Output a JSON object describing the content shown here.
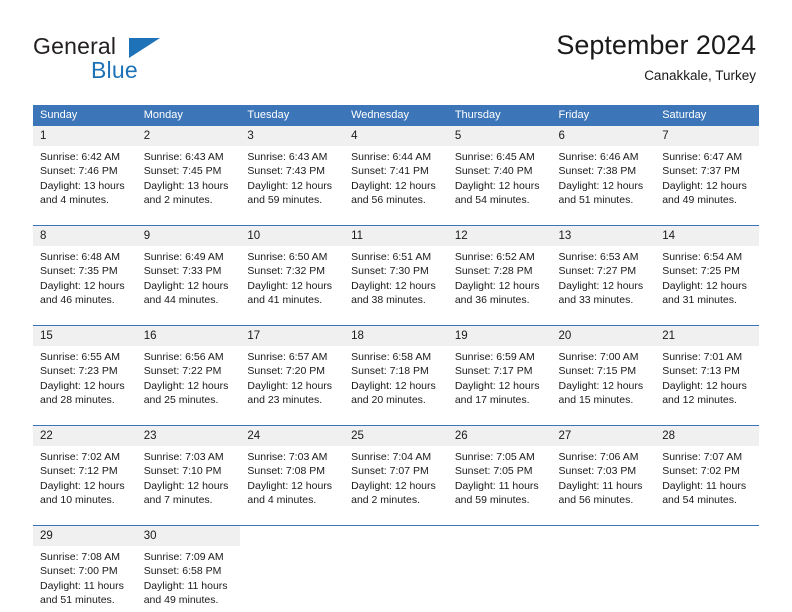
{
  "brand": {
    "name_top": "General",
    "name_bottom": "Blue",
    "triangle_icon": "blue-triangle-logo-mark",
    "accent_color": "#1e72b8"
  },
  "header": {
    "title": "September 2024",
    "subtitle": "Canakkale, Turkey"
  },
  "theme": {
    "header_blue": "#3d76b8",
    "daynum_band": "#f0f0f0",
    "cell_background": "#ffffff",
    "text": "#1a1a1a"
  },
  "weekdays": [
    "Sunday",
    "Monday",
    "Tuesday",
    "Wednesday",
    "Thursday",
    "Friday",
    "Saturday"
  ],
  "weeks": [
    [
      {
        "day": "1",
        "sunrise": "Sunrise: 6:42 AM",
        "sunset": "Sunset: 7:46 PM",
        "daylight_1": "Daylight: 13 hours",
        "daylight_2": "and 4 minutes."
      },
      {
        "day": "2",
        "sunrise": "Sunrise: 6:43 AM",
        "sunset": "Sunset: 7:45 PM",
        "daylight_1": "Daylight: 13 hours",
        "daylight_2": "and 2 minutes."
      },
      {
        "day": "3",
        "sunrise": "Sunrise: 6:43 AM",
        "sunset": "Sunset: 7:43 PM",
        "daylight_1": "Daylight: 12 hours",
        "daylight_2": "and 59 minutes."
      },
      {
        "day": "4",
        "sunrise": "Sunrise: 6:44 AM",
        "sunset": "Sunset: 7:41 PM",
        "daylight_1": "Daylight: 12 hours",
        "daylight_2": "and 56 minutes."
      },
      {
        "day": "5",
        "sunrise": "Sunrise: 6:45 AM",
        "sunset": "Sunset: 7:40 PM",
        "daylight_1": "Daylight: 12 hours",
        "daylight_2": "and 54 minutes."
      },
      {
        "day": "6",
        "sunrise": "Sunrise: 6:46 AM",
        "sunset": "Sunset: 7:38 PM",
        "daylight_1": "Daylight: 12 hours",
        "daylight_2": "and 51 minutes."
      },
      {
        "day": "7",
        "sunrise": "Sunrise: 6:47 AM",
        "sunset": "Sunset: 7:37 PM",
        "daylight_1": "Daylight: 12 hours",
        "daylight_2": "and 49 minutes."
      }
    ],
    [
      {
        "day": "8",
        "sunrise": "Sunrise: 6:48 AM",
        "sunset": "Sunset: 7:35 PM",
        "daylight_1": "Daylight: 12 hours",
        "daylight_2": "and 46 minutes."
      },
      {
        "day": "9",
        "sunrise": "Sunrise: 6:49 AM",
        "sunset": "Sunset: 7:33 PM",
        "daylight_1": "Daylight: 12 hours",
        "daylight_2": "and 44 minutes."
      },
      {
        "day": "10",
        "sunrise": "Sunrise: 6:50 AM",
        "sunset": "Sunset: 7:32 PM",
        "daylight_1": "Daylight: 12 hours",
        "daylight_2": "and 41 minutes."
      },
      {
        "day": "11",
        "sunrise": "Sunrise: 6:51 AM",
        "sunset": "Sunset: 7:30 PM",
        "daylight_1": "Daylight: 12 hours",
        "daylight_2": "and 38 minutes."
      },
      {
        "day": "12",
        "sunrise": "Sunrise: 6:52 AM",
        "sunset": "Sunset: 7:28 PM",
        "daylight_1": "Daylight: 12 hours",
        "daylight_2": "and 36 minutes."
      },
      {
        "day": "13",
        "sunrise": "Sunrise: 6:53 AM",
        "sunset": "Sunset: 7:27 PM",
        "daylight_1": "Daylight: 12 hours",
        "daylight_2": "and 33 minutes."
      },
      {
        "day": "14",
        "sunrise": "Sunrise: 6:54 AM",
        "sunset": "Sunset: 7:25 PM",
        "daylight_1": "Daylight: 12 hours",
        "daylight_2": "and 31 minutes."
      }
    ],
    [
      {
        "day": "15",
        "sunrise": "Sunrise: 6:55 AM",
        "sunset": "Sunset: 7:23 PM",
        "daylight_1": "Daylight: 12 hours",
        "daylight_2": "and 28 minutes."
      },
      {
        "day": "16",
        "sunrise": "Sunrise: 6:56 AM",
        "sunset": "Sunset: 7:22 PM",
        "daylight_1": "Daylight: 12 hours",
        "daylight_2": "and 25 minutes."
      },
      {
        "day": "17",
        "sunrise": "Sunrise: 6:57 AM",
        "sunset": "Sunset: 7:20 PM",
        "daylight_1": "Daylight: 12 hours",
        "daylight_2": "and 23 minutes."
      },
      {
        "day": "18",
        "sunrise": "Sunrise: 6:58 AM",
        "sunset": "Sunset: 7:18 PM",
        "daylight_1": "Daylight: 12 hours",
        "daylight_2": "and 20 minutes."
      },
      {
        "day": "19",
        "sunrise": "Sunrise: 6:59 AM",
        "sunset": "Sunset: 7:17 PM",
        "daylight_1": "Daylight: 12 hours",
        "daylight_2": "and 17 minutes."
      },
      {
        "day": "20",
        "sunrise": "Sunrise: 7:00 AM",
        "sunset": "Sunset: 7:15 PM",
        "daylight_1": "Daylight: 12 hours",
        "daylight_2": "and 15 minutes."
      },
      {
        "day": "21",
        "sunrise": "Sunrise: 7:01 AM",
        "sunset": "Sunset: 7:13 PM",
        "daylight_1": "Daylight: 12 hours",
        "daylight_2": "and 12 minutes."
      }
    ],
    [
      {
        "day": "22",
        "sunrise": "Sunrise: 7:02 AM",
        "sunset": "Sunset: 7:12 PM",
        "daylight_1": "Daylight: 12 hours",
        "daylight_2": "and 10 minutes."
      },
      {
        "day": "23",
        "sunrise": "Sunrise: 7:03 AM",
        "sunset": "Sunset: 7:10 PM",
        "daylight_1": "Daylight: 12 hours",
        "daylight_2": "and 7 minutes."
      },
      {
        "day": "24",
        "sunrise": "Sunrise: 7:03 AM",
        "sunset": "Sunset: 7:08 PM",
        "daylight_1": "Daylight: 12 hours",
        "daylight_2": "and 4 minutes."
      },
      {
        "day": "25",
        "sunrise": "Sunrise: 7:04 AM",
        "sunset": "Sunset: 7:07 PM",
        "daylight_1": "Daylight: 12 hours",
        "daylight_2": "and 2 minutes."
      },
      {
        "day": "26",
        "sunrise": "Sunrise: 7:05 AM",
        "sunset": "Sunset: 7:05 PM",
        "daylight_1": "Daylight: 11 hours",
        "daylight_2": "and 59 minutes."
      },
      {
        "day": "27",
        "sunrise": "Sunrise: 7:06 AM",
        "sunset": "Sunset: 7:03 PM",
        "daylight_1": "Daylight: 11 hours",
        "daylight_2": "and 56 minutes."
      },
      {
        "day": "28",
        "sunrise": "Sunrise: 7:07 AM",
        "sunset": "Sunset: 7:02 PM",
        "daylight_1": "Daylight: 11 hours",
        "daylight_2": "and 54 minutes."
      }
    ],
    [
      {
        "day": "29",
        "sunrise": "Sunrise: 7:08 AM",
        "sunset": "Sunset: 7:00 PM",
        "daylight_1": "Daylight: 11 hours",
        "daylight_2": "and 51 minutes."
      },
      {
        "day": "30",
        "sunrise": "Sunrise: 7:09 AM",
        "sunset": "Sunset: 6:58 PM",
        "daylight_1": "Daylight: 11 hours",
        "daylight_2": "and 49 minutes."
      },
      {
        "day": "",
        "sunrise": "",
        "sunset": "",
        "daylight_1": "",
        "daylight_2": ""
      },
      {
        "day": "",
        "sunrise": "",
        "sunset": "",
        "daylight_1": "",
        "daylight_2": ""
      },
      {
        "day": "",
        "sunrise": "",
        "sunset": "",
        "daylight_1": "",
        "daylight_2": ""
      },
      {
        "day": "",
        "sunrise": "",
        "sunset": "",
        "daylight_1": "",
        "daylight_2": ""
      },
      {
        "day": "",
        "sunrise": "",
        "sunset": "",
        "daylight_1": "",
        "daylight_2": ""
      }
    ]
  ]
}
